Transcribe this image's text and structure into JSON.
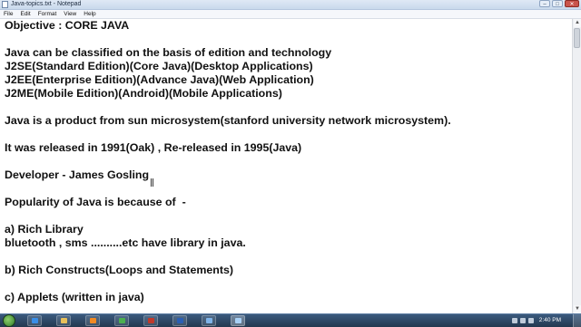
{
  "window": {
    "title": "Java-topics.txt - Notepad",
    "controls": {
      "minimize": "–",
      "maximize": "□",
      "close": "✕"
    }
  },
  "menu": [
    "File",
    "Edit",
    "Format",
    "View",
    "Help"
  ],
  "editor": {
    "lines": [
      "Objective : CORE JAVA",
      "",
      "Java can be classified on the basis of edition and technology",
      "J2SE(Standard Edition)(Core Java)(Desktop Applications)",
      "J2EE(Enterprise Edition)(Advance Java)(Web Application)",
      "J2ME(Mobile Edition)(Android)(Mobile Applications)",
      "",
      "Java is a product from sun microsystem(stanford university network microsystem).",
      "",
      "It was released in 1991(Oak) , Re-released in 1995(Java)",
      "",
      "Developer - James Gosling",
      "",
      "Popularity of Java is because of  -",
      "",
      "a) Rich Library",
      "bluetooth , sms ..........etc have library in java.",
      "",
      "b) Rich Constructs(Loops and Statements)",
      "",
      "c) Applets (written in java)"
    ]
  },
  "taskbar": {
    "clock": "2:40 PM",
    "pinned": [
      {
        "icon": "internet-explorer-icon",
        "color": "#3a8ee6"
      },
      {
        "icon": "folder-icon",
        "color": "#e8c05a"
      },
      {
        "icon": "media-player-icon",
        "color": "#f08a24"
      },
      {
        "icon": "chrome-icon",
        "color": "#4caf50"
      },
      {
        "icon": "camera-icon",
        "color": "#c0392b"
      },
      {
        "icon": "word-icon",
        "color": "#2b5fb4"
      },
      {
        "icon": "paint-icon",
        "color": "#7fb3e8"
      },
      {
        "icon": "notepad-icon",
        "color": "#a8d0f5"
      }
    ]
  }
}
